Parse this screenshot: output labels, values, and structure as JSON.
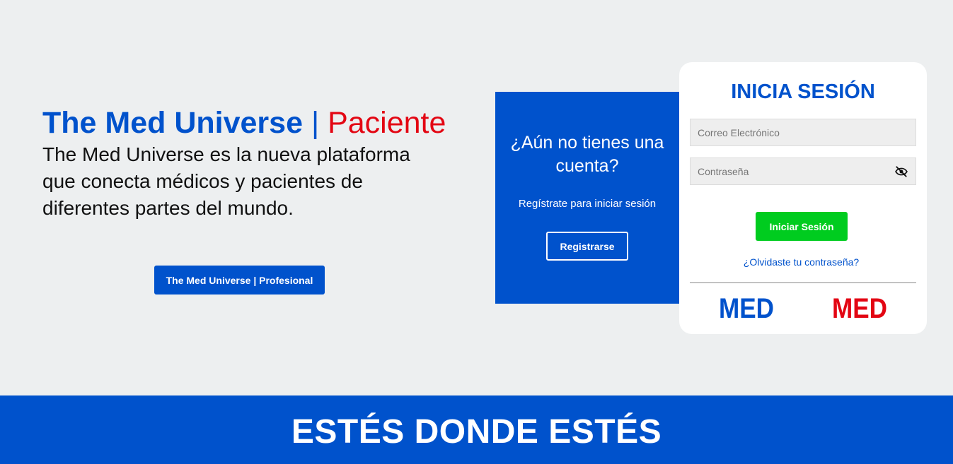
{
  "hero": {
    "brand": "The Med Universe",
    "separator": "|",
    "role": "Paciente",
    "description": "The Med Universe es la nueva plataforma que conecta médicos y pacientes de diferentes partes del mundo.",
    "professional_button": "The Med Universe | Profesional"
  },
  "register_panel": {
    "question": "¿Aún no tienes una cuenta?",
    "subtitle": "Regístrate para iniciar sesión",
    "button": "Registrarse"
  },
  "login": {
    "title": "INICIA SESIÓN",
    "email_placeholder": "Correo Electrónico",
    "email_value": "",
    "password_placeholder": "Contraseña",
    "password_value": "",
    "submit": "Iniciar Sesión",
    "forgot": "¿Olvidaste tu contraseña?",
    "logos": [
      {
        "text": "MED",
        "color": "#0052cc"
      },
      {
        "text": "MED",
        "color": "#e30613"
      }
    ]
  },
  "banner": {
    "text": "ESTÉS DONDE ESTÉS"
  },
  "colors": {
    "primary": "#0052cc",
    "accent_red": "#e30613",
    "success": "#00cc1f",
    "background": "#edeff0"
  }
}
